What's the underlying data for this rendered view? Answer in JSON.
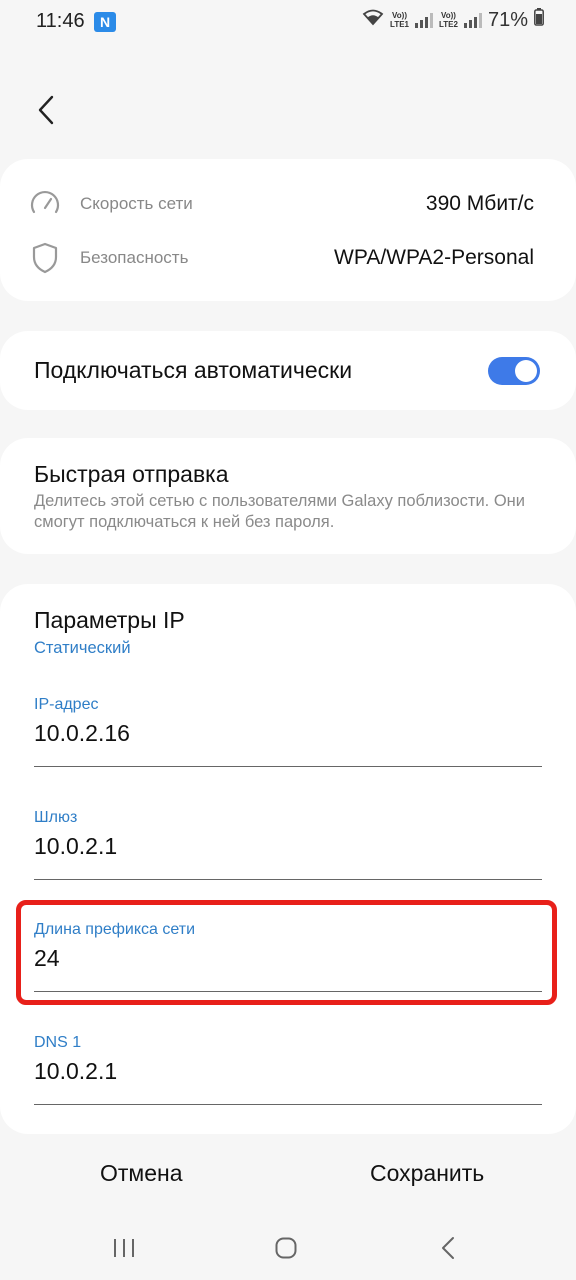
{
  "status_bar": {
    "time": "11:46",
    "app_icon": "N",
    "sim1": {
      "top": "Vo))",
      "bottom": "LTE1"
    },
    "sim2": {
      "top": "Vo))",
      "bottom": "LTE2"
    },
    "battery": "71%"
  },
  "network_info": {
    "speed_label": "Скорость сети",
    "speed_value": "390 Мбит/с",
    "security_label": "Безопасность",
    "security_value": "WPA/WPA2-Personal"
  },
  "auto_connect": {
    "label": "Подключаться автоматически",
    "enabled": true
  },
  "quick_share": {
    "title": "Быстрая отправка",
    "description": "Делитесь этой сетью с пользователями Galaxy поблизости. Они смогут подключаться к ней без пароля."
  },
  "ip_settings": {
    "title": "Параметры IP",
    "mode": "Статический",
    "fields": [
      {
        "label": "IP-адрес",
        "value": "10.0.2.16"
      },
      {
        "label": "Шлюз",
        "value": "10.0.2.1"
      },
      {
        "label": "Длина префикса сети",
        "value": "24"
      },
      {
        "label": "DNS 1",
        "value": "10.0.2.1"
      }
    ]
  },
  "actions": {
    "cancel": "Отмена",
    "save": "Сохранить"
  },
  "colors": {
    "accent": "#2f7ec7",
    "toggle_on": "#3e7ae8",
    "highlight": "#e8201a"
  },
  "icons": [
    "back-icon",
    "speedometer-icon",
    "shield-icon",
    "wifi-icon",
    "battery-icon",
    "recent-apps-icon",
    "home-icon",
    "nav-back-icon"
  ]
}
